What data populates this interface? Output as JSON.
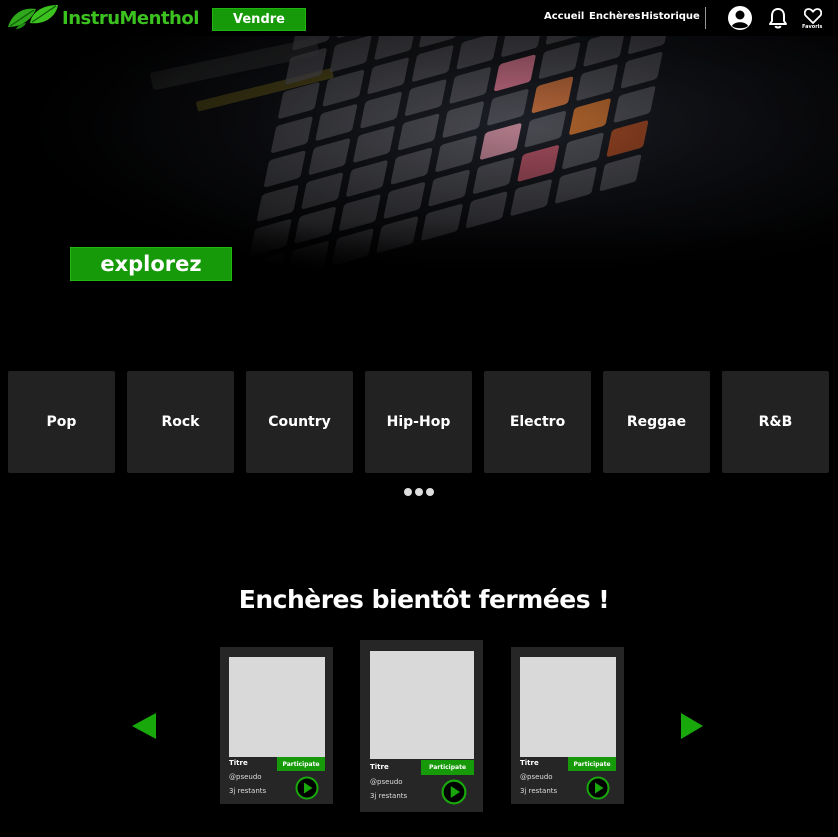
{
  "header": {
    "brand": "InstruMenthol",
    "sell_label": "Vendre",
    "nav": {
      "home": "Accueil",
      "auctions": "Enchères",
      "history": "Historique"
    },
    "favorites_label": "Favoris",
    "icons": [
      "leaf-logo",
      "user-icon",
      "bell-icon",
      "heart-icon"
    ],
    "accent_color": "#169a0a"
  },
  "hero": {
    "cta_label": "explorez"
  },
  "genres": {
    "items": [
      "Pop",
      "Rock",
      "Country",
      "Hip-Hop",
      "Electro",
      "Reggae",
      "R&B"
    ],
    "more_icon": "ellipsis-icon"
  },
  "auctions": {
    "title": "Enchères bientôt fermées !",
    "prev_icon": "arrow-left-icon",
    "next_icon": "arrow-right-icon",
    "cards": [
      {
        "title": "Titre",
        "user": "@pseudo",
        "time": "3j restants",
        "cta": "Participate"
      },
      {
        "title": "Titre",
        "user": "@pseudo",
        "time": "3j restants",
        "cta": "Participate"
      },
      {
        "title": "Titre",
        "user": "@pseudo",
        "time": "3j restants",
        "cta": "Participate"
      }
    ]
  }
}
